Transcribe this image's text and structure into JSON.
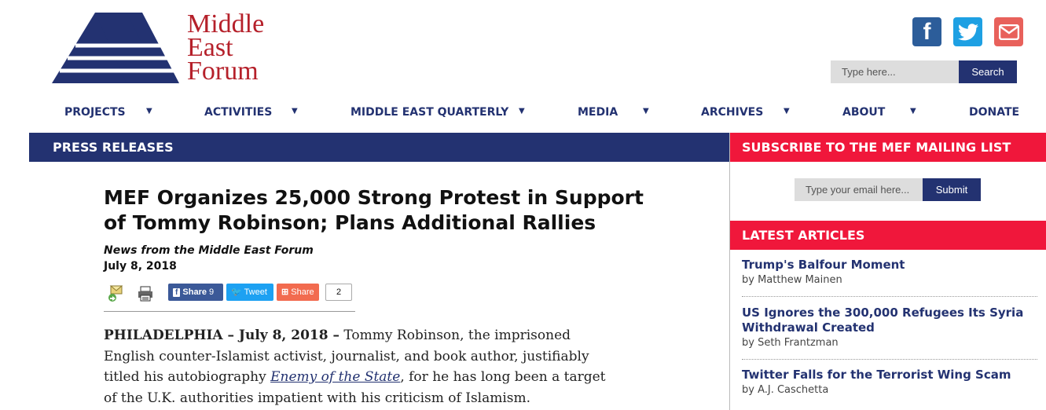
{
  "brand": {
    "line1": "Middle",
    "line2": "East",
    "line3": "Forum",
    "color": "#b5202a",
    "logo_blue": "#233271"
  },
  "social": {
    "facebook": "facebook-icon",
    "twitter": "twitter-icon",
    "email": "email-icon"
  },
  "search": {
    "placeholder": "Type here...",
    "button": "Search"
  },
  "nav": [
    {
      "label": "PROJECTS",
      "has_menu": true
    },
    {
      "label": "ACTIVITIES",
      "has_menu": true
    },
    {
      "label": "MIDDLE EAST QUARTERLY",
      "has_menu": true
    },
    {
      "label": "MEDIA",
      "has_menu": true
    },
    {
      "label": "ARCHIVES",
      "has_menu": true
    },
    {
      "label": "ABOUT",
      "has_menu": true
    },
    {
      "label": "DONATE",
      "has_menu": false
    }
  ],
  "section": {
    "title": "PRESS RELEASES"
  },
  "article": {
    "title": "MEF Organizes 25,000 Strong Protest in Support of Tommy Robinson; Plans Additional Rallies",
    "source": "News from the Middle East Forum",
    "date": "July 8, 2018",
    "share": {
      "facebook_label": "Share",
      "facebook_count": "9",
      "tweet_label": "Tweet",
      "share_label": "Share",
      "total_count": "2"
    },
    "dateline": "PHILADELPHIA – July 8, 2018 –",
    "body_part1": " Tommy Robinson, the imprisoned English counter-Islamist activist, journalist, and book author, justifiably titled his autobiography ",
    "book_title": "Enemy of the State",
    "body_part2": ", for he has long been a target of the U.K. authorities impatient with his criticism of Islamism."
  },
  "sidebar": {
    "subscribe_title": "SUBSCRIBE TO THE MEF MAILING LIST",
    "email_placeholder": "Type your email here...",
    "submit": "Submit",
    "latest_title": "LATEST ARTICLES",
    "articles": [
      {
        "title": "Trump's Balfour Moment",
        "author": "by Matthew Mainen"
      },
      {
        "title": "US Ignores the 300,000 Refugees Its Syria Withdrawal Created",
        "author": "by Seth Frantzman"
      },
      {
        "title": "Twitter Falls for the Terrorist Wing Scam",
        "author": "by A.J. Caschetta"
      }
    ],
    "accent": "#f0173b"
  }
}
